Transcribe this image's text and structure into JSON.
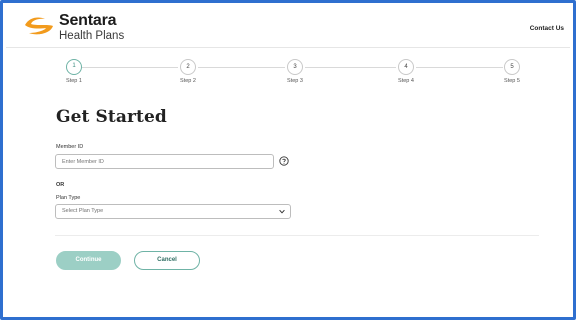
{
  "header": {
    "brand": "Sentara",
    "brand_sub": "Health Plans",
    "contact_label": "Contact Us"
  },
  "stepper": {
    "current": 1,
    "steps": [
      {
        "number": "1",
        "label": "Step 1"
      },
      {
        "number": "2",
        "label": "Step 2"
      },
      {
        "number": "3",
        "label": "Step 3"
      },
      {
        "number": "4",
        "label": "Step 4"
      },
      {
        "number": "5",
        "label": "Step 5"
      }
    ]
  },
  "form": {
    "title": "Get Started",
    "member_id_label": "Member ID",
    "member_id_value": "",
    "member_id_placeholder": "Enter Member ID",
    "or_text": "OR",
    "plan_type_label": "Plan Type",
    "plan_type_selected": "Select Plan Type"
  },
  "actions": {
    "continue_label": "Continue",
    "cancel_label": "Cancel"
  },
  "colors": {
    "frame_border": "#2f6fcf",
    "logo_orange": "#f29b1d",
    "accent_teal": "#6fb3a6",
    "continue_disabled": "#9ccfc5"
  }
}
